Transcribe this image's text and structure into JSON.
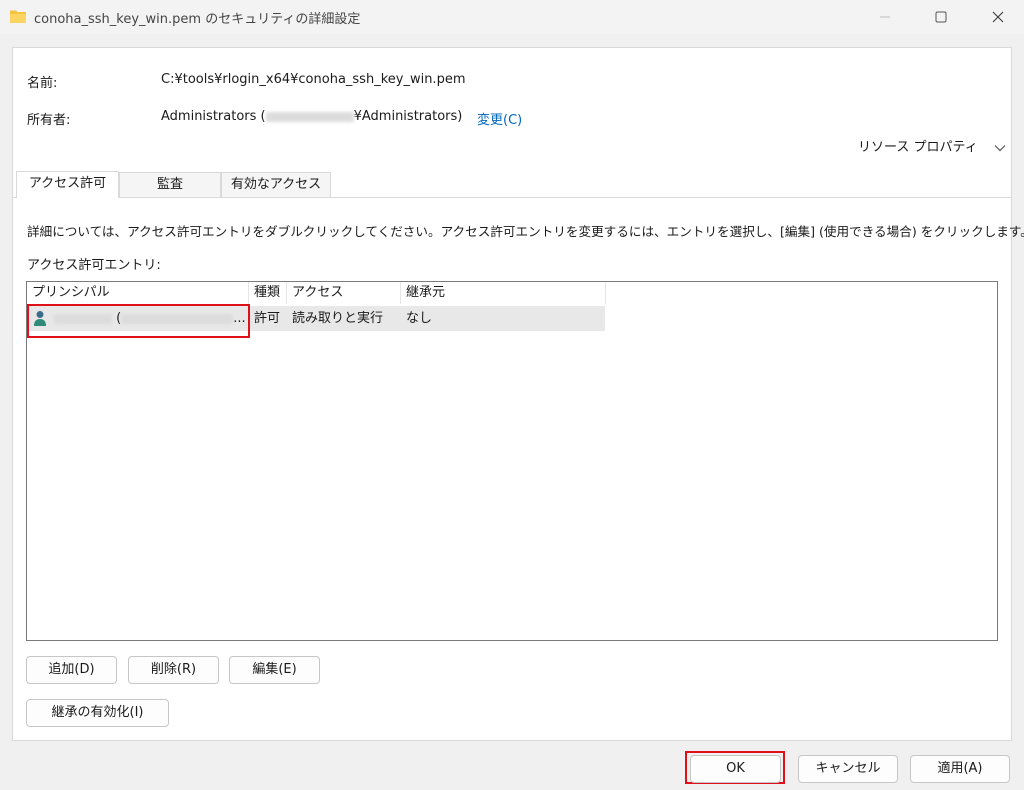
{
  "window": {
    "title": "conoha_ssh_key_win.pem のセキュリティの詳細設定",
    "folder_icon": "folder-icon"
  },
  "info": {
    "name_label": "名前:",
    "name_value": "C:¥tools¥rlogin_x64¥conoha_ssh_key_win.pem",
    "owner_label": "所有者:",
    "owner_value_prefix": "Administrators (",
    "owner_value_suffix": "¥Administrators)",
    "owner_change_link": "変更(C)",
    "resource_properties": "リソース プロパティ"
  },
  "tabs": [
    {
      "label": "アクセス許可",
      "active": true
    },
    {
      "label": "監査",
      "active": false
    },
    {
      "label": "有効なアクセス",
      "active": false
    }
  ],
  "permissions": {
    "description": "詳細については、アクセス許可エントリをダブルクリックしてください。アクセス許可エントリを変更するには、エントリを選択し、[編集] (使用できる場合) をクリックします。",
    "entries_label": "アクセス許可エントリ:",
    "columns": [
      "プリンシパル",
      "種類",
      "アクセス",
      "継承元"
    ],
    "rows": [
      {
        "principal_suffix": "(",
        "principal_ellipsis": "...",
        "type": "許可",
        "access": "読み取りと実行",
        "inherited_from": "なし"
      }
    ]
  },
  "buttons": {
    "add": "追加(D)",
    "remove": "削除(R)",
    "edit": "編集(E)",
    "enable_inheritance": "継承の有効化(I)",
    "ok": "OK",
    "cancel": "キャンセル",
    "apply": "適用(A)"
  },
  "colors": {
    "highlight": "#e0101a",
    "link": "#0067c0",
    "selected_row": "#e8e8e8"
  }
}
